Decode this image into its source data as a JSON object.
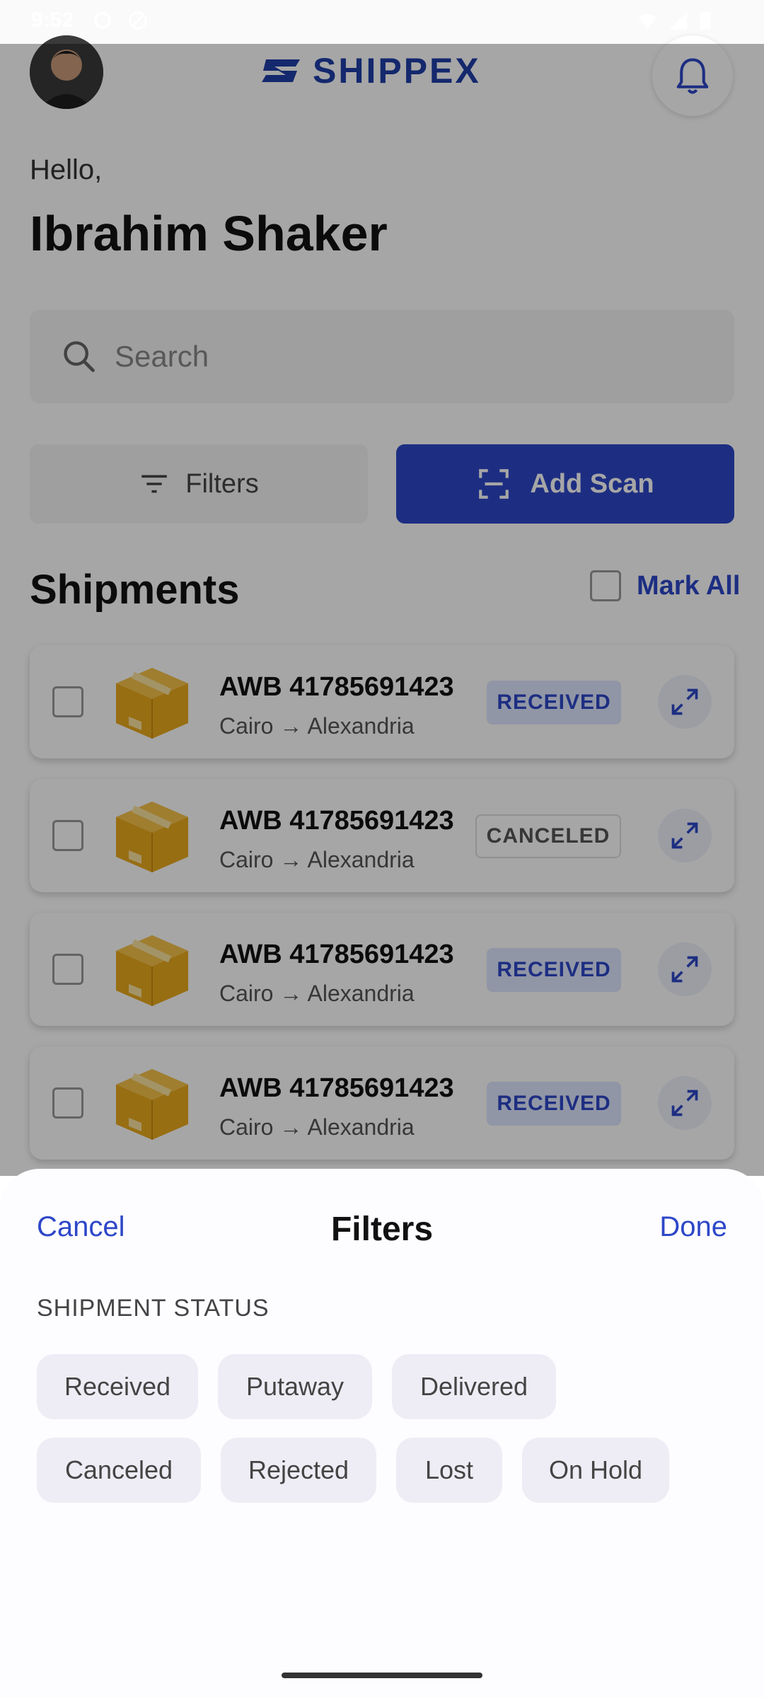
{
  "status_bar": {
    "time": "9:52"
  },
  "header": {
    "brand": "SHIPPEX"
  },
  "greeting": {
    "hello": "Hello,",
    "name": "Ibrahim Shaker"
  },
  "search": {
    "placeholder": "Search"
  },
  "actions": {
    "filters_label": "Filters",
    "add_scan_label": "Add Scan"
  },
  "shipments": {
    "title": "Shipments",
    "mark_all_label": "Mark All",
    "items": [
      {
        "awb": "AWB 41785691423",
        "route": "Cairo → Alexandria",
        "status": "RECEIVED"
      },
      {
        "awb": "AWB 41785691423",
        "route": "Cairo → Alexandria",
        "status": "CANCELED"
      },
      {
        "awb": "AWB 41785691423",
        "route": "Cairo → Alexandria",
        "status": "RECEIVED"
      },
      {
        "awb": "AWB 41785691423",
        "route": "Cairo → Alexandria",
        "status": "RECEIVED"
      }
    ]
  },
  "filter_sheet": {
    "cancel_label": "Cancel",
    "title": "Filters",
    "done_label": "Done",
    "section_title": "SHIPMENT STATUS",
    "chips": [
      "Received",
      "Putaway",
      "Delivered",
      "Canceled",
      "Rejected",
      "Lost",
      "On Hold"
    ]
  },
  "colors": {
    "accent": "#2d47c8",
    "brand": "#1f3ea8",
    "box": "#f2b72b"
  }
}
